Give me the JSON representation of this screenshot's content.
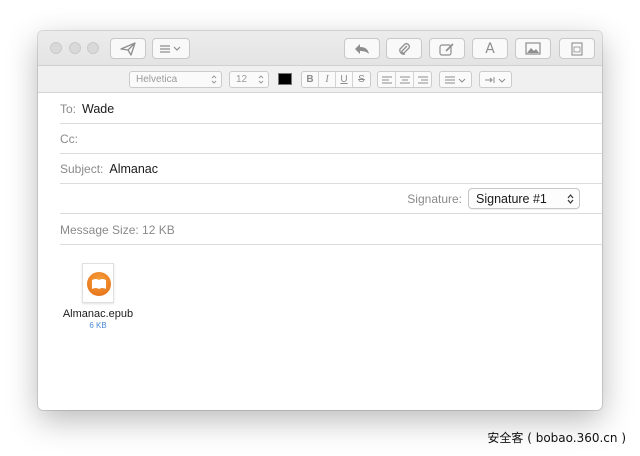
{
  "toolbar": {
    "buttons": [
      "send-icon",
      "header-fields-icon",
      "reply-icon",
      "attachment-icon",
      "markup-icon",
      "format-icon",
      "photo-browser-icon",
      "stationery-icon"
    ],
    "format_glyph": "A"
  },
  "format_bar": {
    "font": "Helvetica",
    "size": "12",
    "text_color": "#000000",
    "styles": [
      "B",
      "I",
      "U",
      "S"
    ],
    "alignment": [
      "align-left-icon",
      "align-center-icon",
      "align-right-icon"
    ],
    "list_icon": "list-icon",
    "indent_icon": "indent-icon"
  },
  "compose": {
    "to_label": "To:",
    "to_value": "Wade",
    "cc_label": "Cc:",
    "cc_value": "",
    "subject_label": "Subject:",
    "subject_value": "Almanac",
    "signature_label": "Signature:",
    "signature_value": "Signature #1",
    "message_size": "Message Size: 12 KB"
  },
  "attachment": {
    "name": "Almanac.epub",
    "size": "6 KB",
    "icon": "ibooks-icon"
  },
  "watermark": "安全客 ( bobao.360.cn )"
}
